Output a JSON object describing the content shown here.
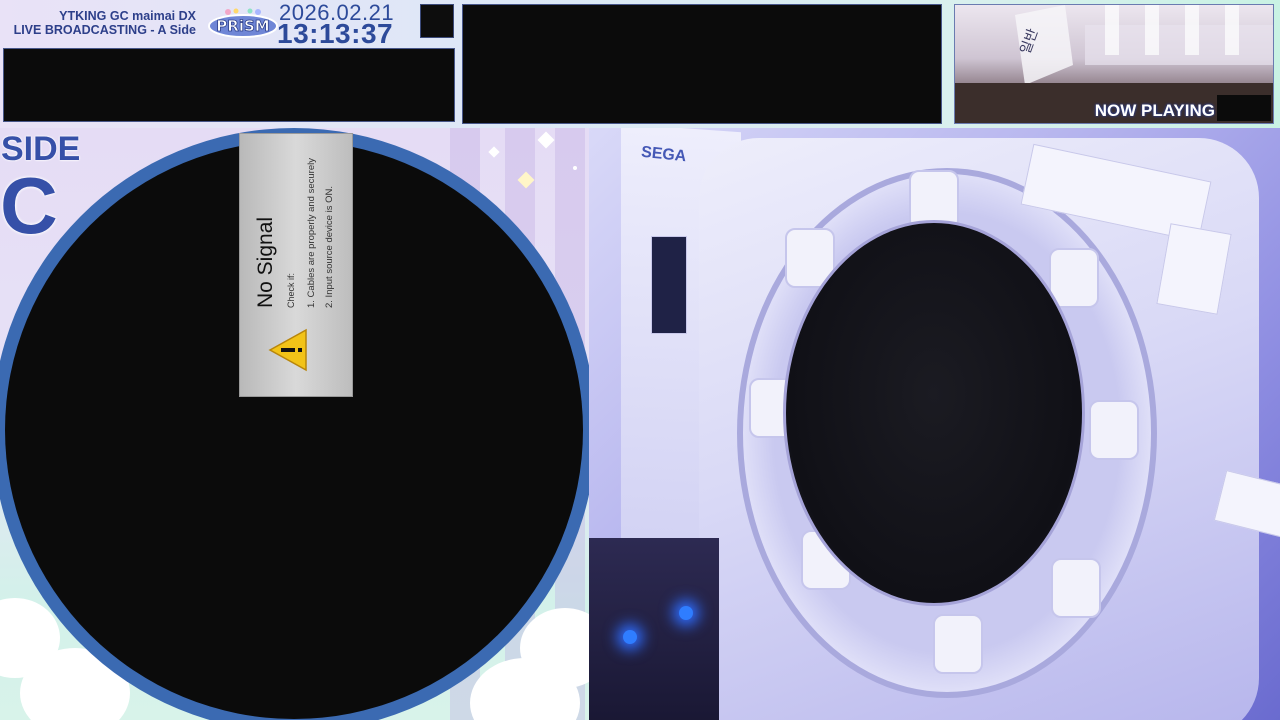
{
  "header": {
    "title_line1": "YTKING GC maimai DX",
    "title_line2": "LIVE BROADCASTING - A Side",
    "date": "2026.02.21",
    "time": "13:13:37",
    "logo_icon": "prism-logo-icon"
  },
  "now_playing": {
    "label": "NOW PLAYING"
  },
  "side": {
    "label": "SIDE",
    "letter": "C"
  },
  "no_signal": {
    "title": "No Signal",
    "check": "Check if:",
    "line1": "1. Cables are properly and securely",
    "line2": "2. Input source device is ON.",
    "icon": "warning-icon"
  },
  "camera": {
    "brand": "SEGA"
  },
  "colors": {
    "accent_blue": "#3650a8",
    "ring_blue": "#3b6ab2",
    "panel_black": "#0b0b0b"
  }
}
